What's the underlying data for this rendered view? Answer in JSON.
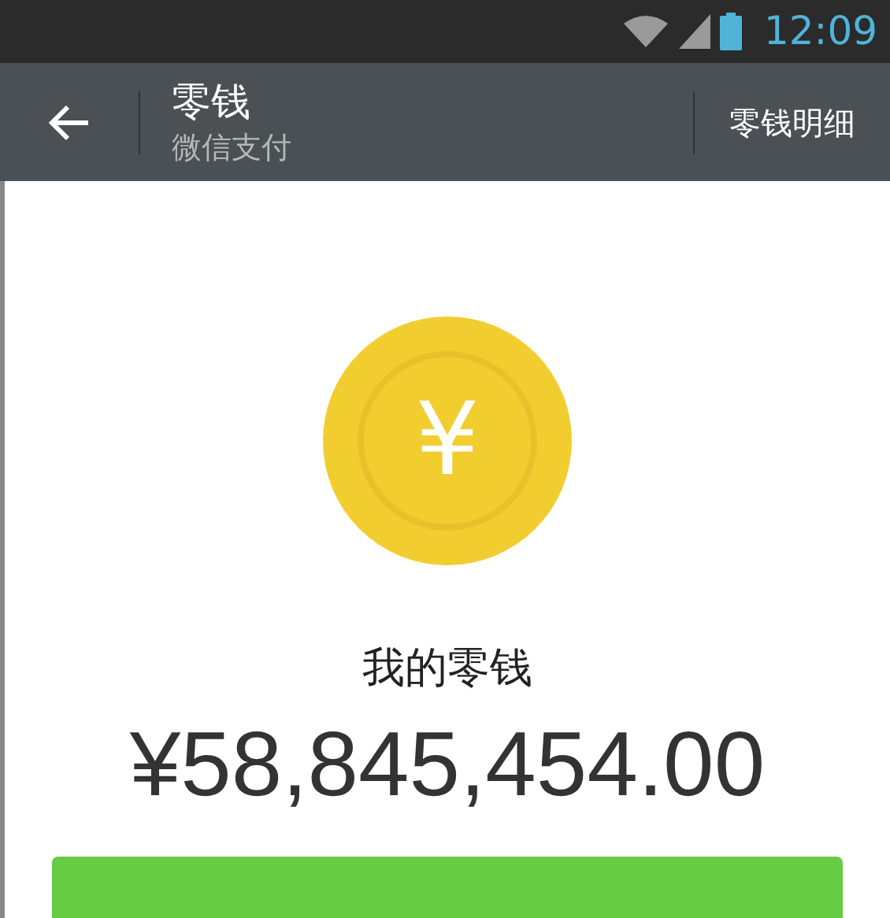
{
  "status_bar": {
    "time": "12:09"
  },
  "app_bar": {
    "title": "零钱",
    "subtitle": "微信支付",
    "action": "零钱明细"
  },
  "balance": {
    "symbol": "¥",
    "label": "我的零钱",
    "amount": "¥58,845,454.00"
  }
}
